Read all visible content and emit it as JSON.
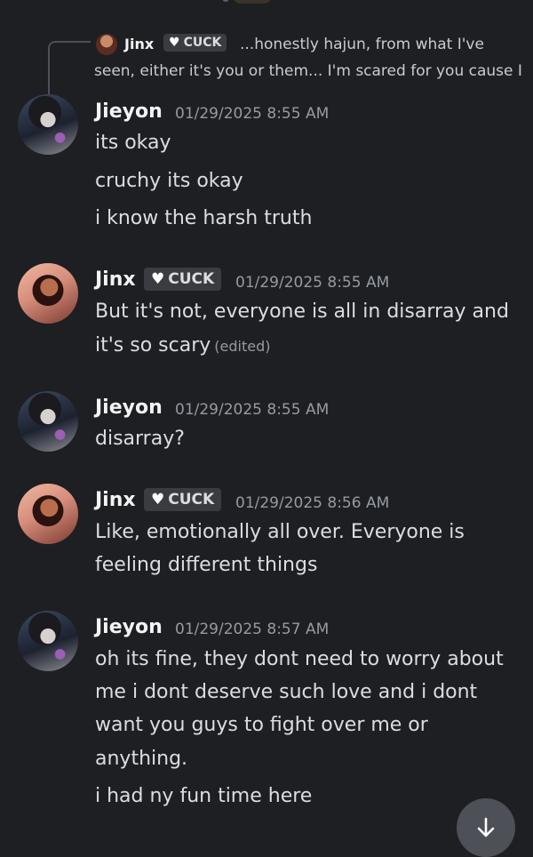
{
  "reply": {
    "name": "Jinx",
    "tag_heart": "♥",
    "tag": "CUCK",
    "text_line1": "...honestly hajun, from what I've",
    "text_line2": "seen, either it's you or them... I'm scared for you cause I"
  },
  "messages": [
    {
      "author": "Jieyon",
      "timestamp": "01/29/2025 8:55 AM",
      "lines": [
        "its okay",
        "cruchy its okay",
        "i know the harsh truth"
      ]
    },
    {
      "author": "Jinx",
      "tag_heart": "♥",
      "tag": "CUCK",
      "timestamp": "01/29/2025 8:55 AM",
      "lines": [
        "But it's not, everyone is all in disarray and",
        "it's so scary"
      ],
      "edited": "(edited)"
    },
    {
      "author": "Jieyon",
      "timestamp": "01/29/2025 8:55 AM",
      "lines": [
        "disarray?"
      ]
    },
    {
      "author": "Jinx",
      "tag_heart": "♥",
      "tag": "CUCK",
      "timestamp": "01/29/2025 8:56 AM",
      "lines": [
        "Like, emotionally all over. Everyone is",
        "feeling different things"
      ]
    },
    {
      "author": "Jieyon",
      "timestamp": "01/29/2025 8:57 AM",
      "lines": [
        "oh its fine, they dont need to worry about",
        "me i dont deserve such love and i dont",
        "want you guys to fight over me or",
        "anything.",
        "i had ny fun time here"
      ]
    }
  ],
  "icons": {
    "scroll_down": "arrow-down-icon"
  },
  "colors": {
    "background": "#1e1f22",
    "username": "#f2f3f5",
    "timestamp": "#949ba4",
    "tag_bg": "#3a3c42"
  }
}
